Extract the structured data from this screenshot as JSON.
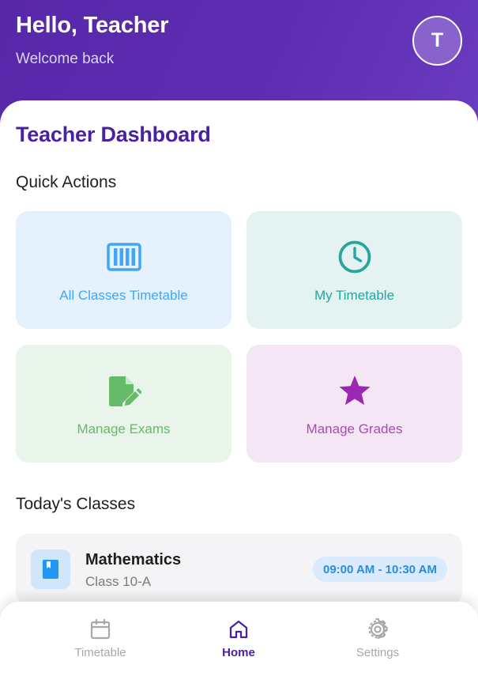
{
  "header": {
    "greeting": "Hello, Teacher",
    "subtitle": "Welcome back",
    "avatar_initial": "T"
  },
  "main": {
    "title": "Teacher Dashboard",
    "quick_actions_title": "Quick Actions",
    "quick_actions": [
      {
        "label": "All Classes Timetable",
        "icon": "timetable-columns-icon",
        "color": "#42a5f5",
        "bg": "#e5f2fd"
      },
      {
        "label": "My Timetable",
        "icon": "clock-icon",
        "color": "#26a69a",
        "bg": "#e4f2f1"
      },
      {
        "label": "Manage Exams",
        "icon": "edit-document-icon",
        "color": "#66bb6a",
        "bg": "#e9f5ea"
      },
      {
        "label": "Manage Grades",
        "icon": "star-icon",
        "color": "#ab47bc",
        "bg": "#f4e6f5"
      }
    ],
    "todays_classes_title": "Today's Classes",
    "classes": [
      {
        "subject": "Mathematics",
        "class_name": "Class 10-A",
        "time": "09:00 AM - 10:30 AM",
        "icon": "book-icon"
      }
    ]
  },
  "bottom_nav": {
    "items": [
      {
        "label": "Timetable",
        "icon": "calendar-icon",
        "active": false
      },
      {
        "label": "Home",
        "icon": "home-icon",
        "active": true
      },
      {
        "label": "Settings",
        "icon": "gear-icon",
        "active": false
      }
    ],
    "active_color": "#4a22a0",
    "inactive_color": "#a8a8a8"
  }
}
